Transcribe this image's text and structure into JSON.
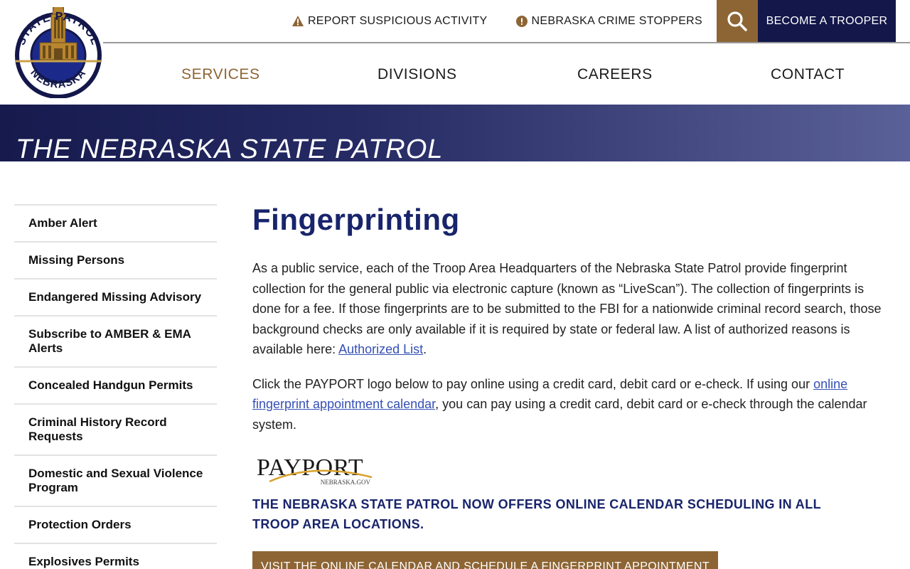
{
  "header": {
    "logo": {
      "text_top": "STATE PATROL",
      "text_bottom": "NEBRASKA"
    },
    "utility": {
      "report_label": "REPORT SUSPICIOUS ACTIVITY",
      "crimestoppers_label": "NEBRASKA CRIME STOPPERS",
      "become_trooper_label": "BECOME A TROOPER"
    },
    "nav": {
      "services": "SERVICES",
      "divisions": "DIVISIONS",
      "careers": "CAREERS",
      "contact": "CONTACT"
    }
  },
  "banner": {
    "title": "THE NEBRASKA STATE PATROL"
  },
  "sidebar": {
    "items": [
      {
        "label": "Amber Alert"
      },
      {
        "label": "Missing Persons"
      },
      {
        "label": "Endangered Missing Advisory"
      },
      {
        "label": "Subscribe to AMBER & EMA Alerts"
      },
      {
        "label": "Concealed Handgun Permits"
      },
      {
        "label": "Criminal History Record Requests"
      },
      {
        "label": "Domestic and Sexual Violence Program"
      },
      {
        "label": "Protection Orders"
      },
      {
        "label": "Explosives Permits"
      }
    ]
  },
  "content": {
    "title": "Fingerprinting",
    "para1_text": "As a public service, each of the Troop Area Headquarters of the Nebraska State Patrol provide fingerprint collection for the general public via electronic capture (known as “LiveScan”).  The collection of fingerprints is done for a fee.  If those fingerprints are to be submitted to the FBI for a nationwide criminal record search, those background checks are only available if it is required by state or federal law. A list of authorized reasons is available here: ",
    "para1_link": "Authorized List",
    "para1_end": ".",
    "para2_text": "Click the PAYPORT logo below to pay online using a credit card, debit card or e-check. If using our ",
    "para2_link": "online fingerprint appointment calendar",
    "para2_end": ", you can pay using a credit card, debit card or e-check through the calendar system.",
    "payport": {
      "name": "PAYPORT",
      "sub": "NEBRASKA.GOV"
    },
    "notice": "THE NEBRASKA STATE PATROL NOW OFFERS ONLINE CALENDAR SCHEDULING IN ALL TROOP AREA LOCATIONS.",
    "cta_label": "VISIT THE ONLINE CALENDAR AND SCHEDULE A FINGERPRINT APPOINTMENT"
  },
  "colors": {
    "navy": "#13174a",
    "title_navy": "#18246b",
    "brown_accent": "#8d6534",
    "link_blue": "#3650b5"
  }
}
